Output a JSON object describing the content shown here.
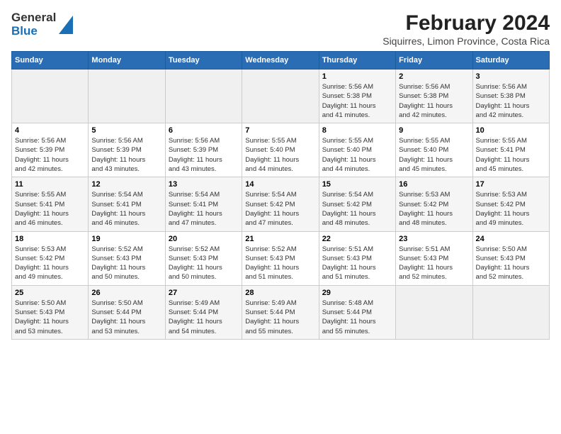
{
  "logo": {
    "line1": "General",
    "line2": "Blue"
  },
  "title": "February 2024",
  "subtitle": "Siquirres, Limon Province, Costa Rica",
  "headers": [
    "Sunday",
    "Monday",
    "Tuesday",
    "Wednesday",
    "Thursday",
    "Friday",
    "Saturday"
  ],
  "weeks": [
    [
      {
        "day": "",
        "info": ""
      },
      {
        "day": "",
        "info": ""
      },
      {
        "day": "",
        "info": ""
      },
      {
        "day": "",
        "info": ""
      },
      {
        "day": "1",
        "info": "Sunrise: 5:56 AM\nSunset: 5:38 PM\nDaylight: 11 hours\nand 41 minutes."
      },
      {
        "day": "2",
        "info": "Sunrise: 5:56 AM\nSunset: 5:38 PM\nDaylight: 11 hours\nand 42 minutes."
      },
      {
        "day": "3",
        "info": "Sunrise: 5:56 AM\nSunset: 5:38 PM\nDaylight: 11 hours\nand 42 minutes."
      }
    ],
    [
      {
        "day": "4",
        "info": "Sunrise: 5:56 AM\nSunset: 5:39 PM\nDaylight: 11 hours\nand 42 minutes."
      },
      {
        "day": "5",
        "info": "Sunrise: 5:56 AM\nSunset: 5:39 PM\nDaylight: 11 hours\nand 43 minutes."
      },
      {
        "day": "6",
        "info": "Sunrise: 5:56 AM\nSunset: 5:39 PM\nDaylight: 11 hours\nand 43 minutes."
      },
      {
        "day": "7",
        "info": "Sunrise: 5:55 AM\nSunset: 5:40 PM\nDaylight: 11 hours\nand 44 minutes."
      },
      {
        "day": "8",
        "info": "Sunrise: 5:55 AM\nSunset: 5:40 PM\nDaylight: 11 hours\nand 44 minutes."
      },
      {
        "day": "9",
        "info": "Sunrise: 5:55 AM\nSunset: 5:40 PM\nDaylight: 11 hours\nand 45 minutes."
      },
      {
        "day": "10",
        "info": "Sunrise: 5:55 AM\nSunset: 5:41 PM\nDaylight: 11 hours\nand 45 minutes."
      }
    ],
    [
      {
        "day": "11",
        "info": "Sunrise: 5:55 AM\nSunset: 5:41 PM\nDaylight: 11 hours\nand 46 minutes."
      },
      {
        "day": "12",
        "info": "Sunrise: 5:54 AM\nSunset: 5:41 PM\nDaylight: 11 hours\nand 46 minutes."
      },
      {
        "day": "13",
        "info": "Sunrise: 5:54 AM\nSunset: 5:41 PM\nDaylight: 11 hours\nand 47 minutes."
      },
      {
        "day": "14",
        "info": "Sunrise: 5:54 AM\nSunset: 5:42 PM\nDaylight: 11 hours\nand 47 minutes."
      },
      {
        "day": "15",
        "info": "Sunrise: 5:54 AM\nSunset: 5:42 PM\nDaylight: 11 hours\nand 48 minutes."
      },
      {
        "day": "16",
        "info": "Sunrise: 5:53 AM\nSunset: 5:42 PM\nDaylight: 11 hours\nand 48 minutes."
      },
      {
        "day": "17",
        "info": "Sunrise: 5:53 AM\nSunset: 5:42 PM\nDaylight: 11 hours\nand 49 minutes."
      }
    ],
    [
      {
        "day": "18",
        "info": "Sunrise: 5:53 AM\nSunset: 5:42 PM\nDaylight: 11 hours\nand 49 minutes."
      },
      {
        "day": "19",
        "info": "Sunrise: 5:52 AM\nSunset: 5:43 PM\nDaylight: 11 hours\nand 50 minutes."
      },
      {
        "day": "20",
        "info": "Sunrise: 5:52 AM\nSunset: 5:43 PM\nDaylight: 11 hours\nand 50 minutes."
      },
      {
        "day": "21",
        "info": "Sunrise: 5:52 AM\nSunset: 5:43 PM\nDaylight: 11 hours\nand 51 minutes."
      },
      {
        "day": "22",
        "info": "Sunrise: 5:51 AM\nSunset: 5:43 PM\nDaylight: 11 hours\nand 51 minutes."
      },
      {
        "day": "23",
        "info": "Sunrise: 5:51 AM\nSunset: 5:43 PM\nDaylight: 11 hours\nand 52 minutes."
      },
      {
        "day": "24",
        "info": "Sunrise: 5:50 AM\nSunset: 5:43 PM\nDaylight: 11 hours\nand 52 minutes."
      }
    ],
    [
      {
        "day": "25",
        "info": "Sunrise: 5:50 AM\nSunset: 5:43 PM\nDaylight: 11 hours\nand 53 minutes."
      },
      {
        "day": "26",
        "info": "Sunrise: 5:50 AM\nSunset: 5:44 PM\nDaylight: 11 hours\nand 53 minutes."
      },
      {
        "day": "27",
        "info": "Sunrise: 5:49 AM\nSunset: 5:44 PM\nDaylight: 11 hours\nand 54 minutes."
      },
      {
        "day": "28",
        "info": "Sunrise: 5:49 AM\nSunset: 5:44 PM\nDaylight: 11 hours\nand 55 minutes."
      },
      {
        "day": "29",
        "info": "Sunrise: 5:48 AM\nSunset: 5:44 PM\nDaylight: 11 hours\nand 55 minutes."
      },
      {
        "day": "",
        "info": ""
      },
      {
        "day": "",
        "info": ""
      }
    ]
  ]
}
